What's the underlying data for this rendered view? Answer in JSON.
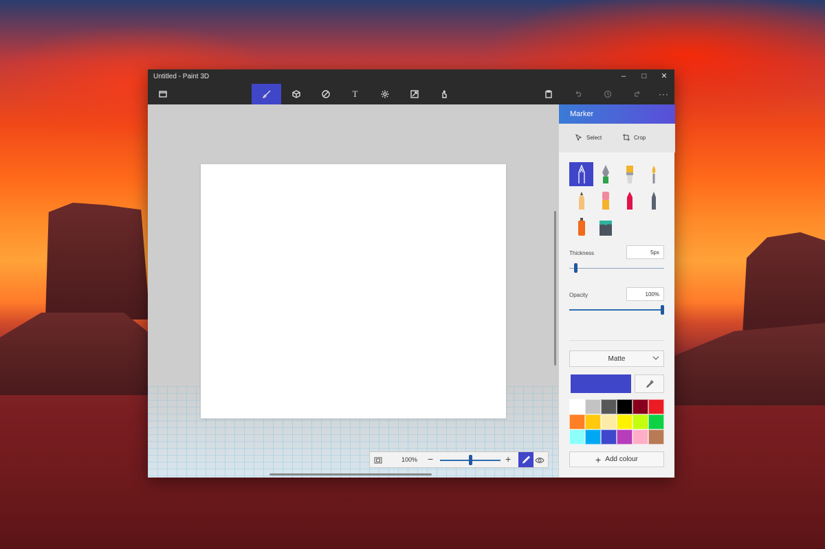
{
  "window": {
    "title": "Untitled - Paint 3D",
    "controls": {
      "minimize": "–",
      "maximize": "□",
      "close": "✕"
    }
  },
  "toolbar": {
    "items": [
      {
        "name": "menu-icon"
      },
      {
        "name": "brushes-icon",
        "active": true
      },
      {
        "name": "3d-shapes-icon"
      },
      {
        "name": "stickers-icon"
      },
      {
        "name": "text-icon"
      },
      {
        "name": "effects-icon"
      },
      {
        "name": "canvas-icon"
      },
      {
        "name": "3d-library-icon"
      },
      {
        "name": "paste-icon"
      },
      {
        "name": "undo-icon",
        "disabled": true
      },
      {
        "name": "history-icon",
        "disabled": true
      },
      {
        "name": "redo-icon",
        "disabled": true
      },
      {
        "name": "more-icon"
      }
    ],
    "text_glyph": "T",
    "more_glyph": "···"
  },
  "zoom": {
    "value": "100%",
    "level": 0.5,
    "minus": "−",
    "plus": "+"
  },
  "panel": {
    "title": "Marker",
    "select_label": "Select",
    "crop_label": "Crop",
    "brushes": [
      {
        "name": "marker",
        "selected": true
      },
      {
        "name": "calligraphy-pen"
      },
      {
        "name": "oil-brush"
      },
      {
        "name": "watercolor"
      },
      {
        "name": "pencil"
      },
      {
        "name": "eraser"
      },
      {
        "name": "crayon"
      },
      {
        "name": "pixel-pen"
      },
      {
        "name": "spray-can"
      },
      {
        "name": "fill"
      }
    ],
    "thickness_label": "Thickness",
    "thickness_value": "5px",
    "thickness_level": 0.05,
    "opacity_label": "Opacity",
    "opacity_value": "100%",
    "opacity_level": 1.0,
    "finish": "Matte",
    "current_color": "#4046c8",
    "add_colour_label": "Add colour",
    "palette": [
      "#ffffff",
      "#c3c3c3",
      "#585858",
      "#000000",
      "#88001b",
      "#ec1c24",
      "#ff7f27",
      "#ffc90e",
      "#fdeca6",
      "#fff200",
      "#c4ff0e",
      "#0ed145",
      "#8cfffb",
      "#00a8f3",
      "#3f48cc",
      "#b83dba",
      "#ffaec8",
      "#b97a56"
    ]
  }
}
